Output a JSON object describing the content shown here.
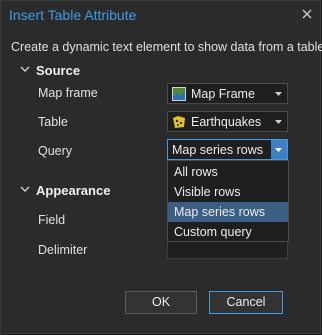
{
  "dialog": {
    "title": "Insert Table Attribute",
    "description": "Create a dynamic text element to show data from a table."
  },
  "source": {
    "heading": "Source",
    "map_frame": {
      "label": "Map frame",
      "value": "Map Frame",
      "icon": "map-frame-icon"
    },
    "table": {
      "label": "Table",
      "value": "Earthquakes",
      "icon": "polygon-layer-icon"
    },
    "query": {
      "label": "Query",
      "value": "Map series rows",
      "options": [
        "All rows",
        "Visible rows",
        "Map series rows",
        "Custom query"
      ],
      "selected_index": 2
    }
  },
  "appearance": {
    "heading": "Appearance",
    "field_label": "Field",
    "delimiter_label": "Delimiter"
  },
  "buttons": {
    "ok": "OK",
    "cancel": "Cancel"
  },
  "colors": {
    "accent": "#3f9be6",
    "selection": "#3b5e84",
    "background": "#2b2b2b"
  }
}
